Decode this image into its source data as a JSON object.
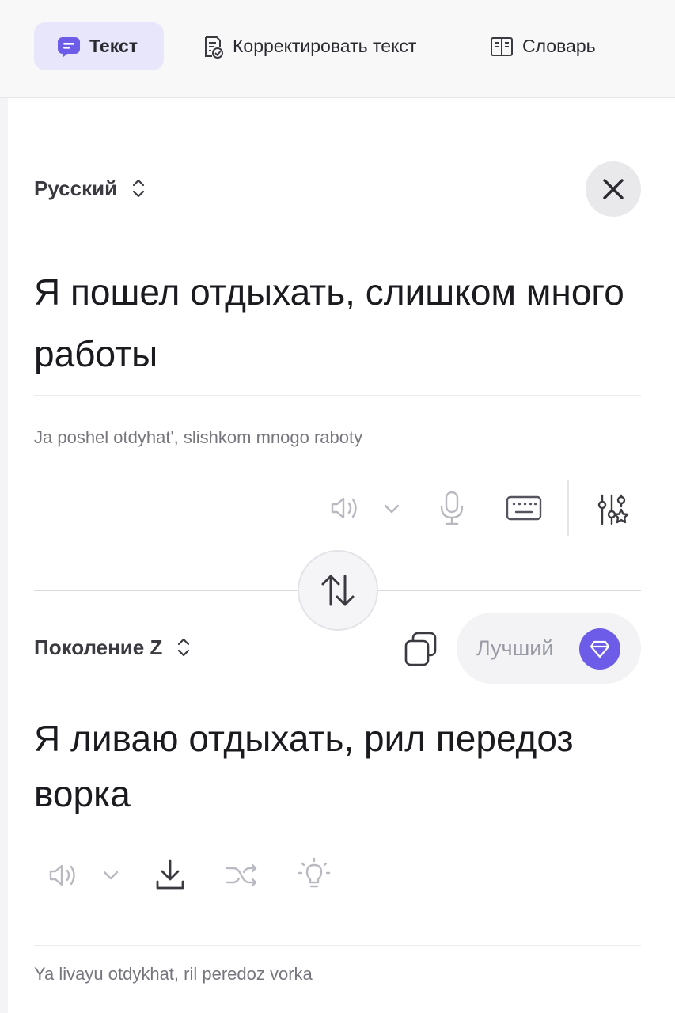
{
  "tabs": [
    {
      "label": "Текст",
      "icon": "chat-bubble-icon",
      "active": true
    },
    {
      "label": "Корректировать текст",
      "icon": "document-check-icon",
      "active": false
    },
    {
      "label": "Словарь",
      "icon": "book-icon",
      "active": false
    }
  ],
  "source": {
    "language": "Русский",
    "text": "Я пошел отдыхать, слишком много работы",
    "transliteration": "Ja poshel otdyhat', slishkom mnogo raboty"
  },
  "target": {
    "language": "Поколение Z",
    "text": "Я ливаю отдыхать, рил передоз ворка",
    "transliteration": "Ya livayu otdykhat, ril peredoz vorka",
    "quality_label": "Лучший"
  },
  "colors": {
    "accent": "#6c5ce7",
    "active_tab_bg": "#e8e6fb",
    "muted_text": "#76767e"
  }
}
